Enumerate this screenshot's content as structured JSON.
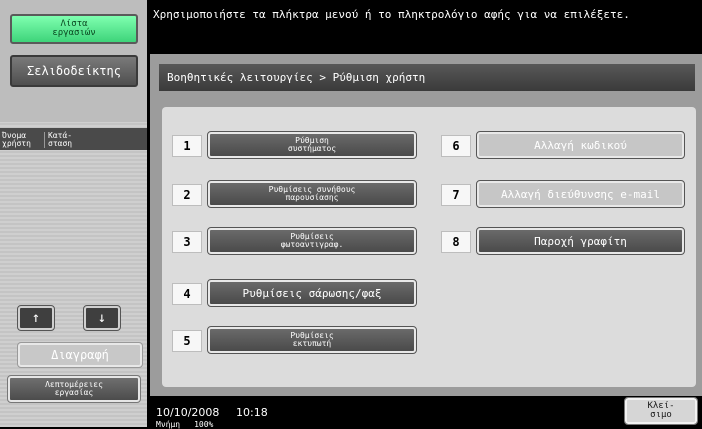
{
  "sidebar": {
    "job_list_label": "Λίστα\nεργασιών",
    "bookmark_label": "Σελιδοδείκτης",
    "col_user": "Όνομα\nχρήστη",
    "col_status": "Κατά-\nσταση",
    "up_icon": "↑",
    "down_icon": "↓",
    "delete_label": "Διαγραφή",
    "job_details_label": "Λεπτομέρειες\nεργασίας"
  },
  "header": {
    "message": "Χρησιμοποιήστε τα πλήκτρα μενού ή το πληκτρολόγιο αφής για να επιλέξετε."
  },
  "breadcrumb": "Βοηθητικές λειτουργίες > Ρύθμιση χρήστη",
  "menu_items": [
    {
      "num": "1",
      "label": "Ρύθμιση\nσυστήματος"
    },
    {
      "num": "2",
      "label": "Ρυθμίσεις συνήθους\nπαρουσίασης"
    },
    {
      "num": "3",
      "label": "Ρυθμίσεις\nφωτοαντιγραφ."
    },
    {
      "num": "4",
      "label": "Ρυθμίσεις σάρωσης/φαξ"
    },
    {
      "num": "5",
      "label": "Ρυθμίσεις\nεκτυπωτή"
    },
    {
      "num": "6",
      "label": "Αλλαγή κωδικού"
    },
    {
      "num": "7",
      "label": "Αλλαγή διεύθυνσης e-mail"
    },
    {
      "num": "8",
      "label": "Παροχή γραφίτη"
    }
  ],
  "footer": {
    "date": "10/10/2008",
    "time": "10:18",
    "memory_label": "Μνήμη",
    "memory_value": "100%",
    "close_label": "Κλεί-\nσιμο"
  },
  "colors": {
    "accent_green": "#3ed47a",
    "panel_gray": "#9c9c9c",
    "button_dark": "#4a4a4a"
  }
}
